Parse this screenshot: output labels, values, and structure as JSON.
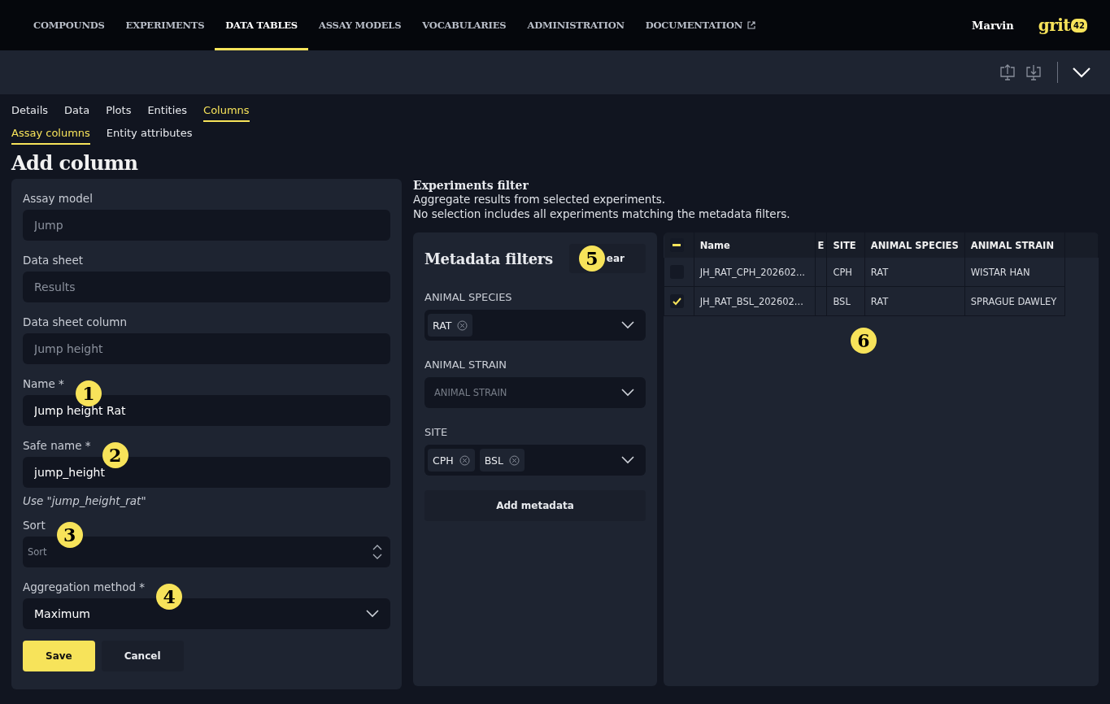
{
  "nav": {
    "items": [
      {
        "label": "COMPOUNDS",
        "selected": false,
        "external": false
      },
      {
        "label": "EXPERIMENTS",
        "selected": false,
        "external": false
      },
      {
        "label": "DATA TABLES",
        "selected": true,
        "external": false
      },
      {
        "label": "ASSAY MODELS",
        "selected": false,
        "external": false
      },
      {
        "label": "VOCABULARIES",
        "selected": false,
        "external": false
      },
      {
        "label": "ADMINISTRATION",
        "selected": false,
        "external": false
      },
      {
        "label": "DOCUMENTATION",
        "selected": false,
        "external": true
      }
    ],
    "user": "Marvin",
    "logo": {
      "text": "grit",
      "badge": "42"
    }
  },
  "tabs": [
    {
      "label": "Details",
      "selected": false
    },
    {
      "label": "Data",
      "selected": false
    },
    {
      "label": "Plots",
      "selected": false
    },
    {
      "label": "Entities",
      "selected": false
    },
    {
      "label": "Columns",
      "selected": true
    }
  ],
  "subtabs": [
    {
      "label": "Assay columns",
      "selected": true
    },
    {
      "label": "Entity attributes",
      "selected": false
    }
  ],
  "heading": "Add column",
  "form": {
    "fields": [
      {
        "kind": "text",
        "label": "Assay model",
        "placeholder": "Jump"
      },
      {
        "kind": "text",
        "label": "Data sheet",
        "placeholder": "Results"
      },
      {
        "kind": "text",
        "label": "Data sheet column",
        "placeholder": "Jump height"
      },
      {
        "kind": "text",
        "label": "Name *",
        "value": "Jump height Rat",
        "callout": "1"
      },
      {
        "kind": "text",
        "label": "Safe name *",
        "value": "jump_height",
        "callout": "2",
        "hint": "Use \"jump_height_rat\""
      },
      {
        "kind": "number",
        "label": "Sort",
        "placeholder": "Sort",
        "callout": "3"
      },
      {
        "kind": "select",
        "label": "Aggregation method *",
        "value": "Maximum",
        "callout": "4"
      }
    ],
    "buttons": [
      {
        "label": "Save",
        "kind": "primary"
      },
      {
        "label": "Cancel",
        "kind": "secondary"
      }
    ]
  },
  "experiments_filter": {
    "title": "Experiments filter",
    "description": [
      "Aggregate results from selected experiments.",
      "No selection includes all experiments matching the metadata filters."
    ],
    "metadata": {
      "title": "Metadata filters",
      "clear_button": "ear",
      "callout": "5",
      "filters": [
        {
          "label": "ANIMAL SPECIES",
          "tags": [
            "RAT"
          ]
        },
        {
          "label": "ANIMAL STRAIN",
          "placeholder": "ANIMAL STRAIN"
        },
        {
          "label": "SITE",
          "tags": [
            "CPH",
            "BSL"
          ]
        }
      ],
      "add_button": "Add metadata"
    },
    "table": {
      "callout": "6",
      "indeterminate": true,
      "columns": [
        "Name",
        "E",
        "SITE",
        "ANIMAL SPECIES",
        "ANIMAL STRAIN"
      ],
      "rows": [
        {
          "selected": false,
          "cells": [
            "JH_RAT_CPH_202602...",
            "",
            "CPH",
            "RAT",
            "WISTAR HAN"
          ]
        },
        {
          "selected": true,
          "cells": [
            "JH_RAT_BSL_202602...",
            "",
            "BSL",
            "RAT",
            "SPRAGUE DAWLEY"
          ]
        }
      ]
    }
  }
}
